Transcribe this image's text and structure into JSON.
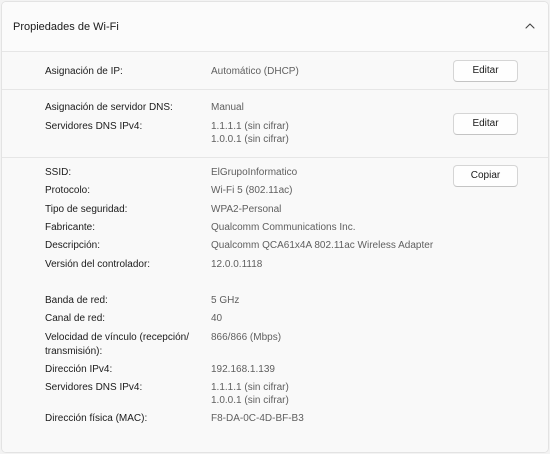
{
  "header": {
    "title": "Propiedades de Wi-Fi"
  },
  "ip_section": {
    "label": "Asignación de IP:",
    "value": "Automático (DHCP)",
    "button": "Editar"
  },
  "dns_section": {
    "assign_label": "Asignación de servidor DNS:",
    "assign_value": "Manual",
    "servers_label": "Servidores DNS IPv4:",
    "servers_value_1": "1.1.1.1 (sin cifrar)",
    "servers_value_2": "1.0.0.1 (sin cifrar)",
    "button": "Editar"
  },
  "details": {
    "button": "Copiar",
    "ssid_label": "SSID:",
    "ssid_value": "ElGrupoInformatico",
    "protocol_label": "Protocolo:",
    "protocol_value": "Wi-Fi 5 (802.11ac)",
    "security_label": "Tipo de seguridad:",
    "security_value": "WPA2-Personal",
    "manufacturer_label": "Fabricante:",
    "manufacturer_value": "Qualcomm Communications Inc.",
    "description_label": "Descripción:",
    "description_value": "Qualcomm QCA61x4A 802.11ac Wireless Adapter",
    "driver_label": "Versión del controlador:",
    "driver_value": "12.0.0.1118",
    "band_label": "Banda de red:",
    "band_value": "5 GHz",
    "channel_label": "Canal de red:",
    "channel_value": "40",
    "speed_label_1": "Velocidad de vínculo (recepción/",
    "speed_label_2": "transmisión):",
    "speed_value": "866/866 (Mbps)",
    "ipv4_label": "Dirección IPv4:",
    "ipv4_value": "192.168.1.139",
    "dns_label": "Servidores DNS IPv4:",
    "dns_value_1": "1.1.1.1 (sin cifrar)",
    "dns_value_2": "1.0.0.1 (sin cifrar)",
    "mac_label": "Dirección física (MAC):",
    "mac_value": "F8-DA-0C-4D-BF-B3"
  },
  "icons": {
    "collapse": "chevron-up-icon"
  }
}
